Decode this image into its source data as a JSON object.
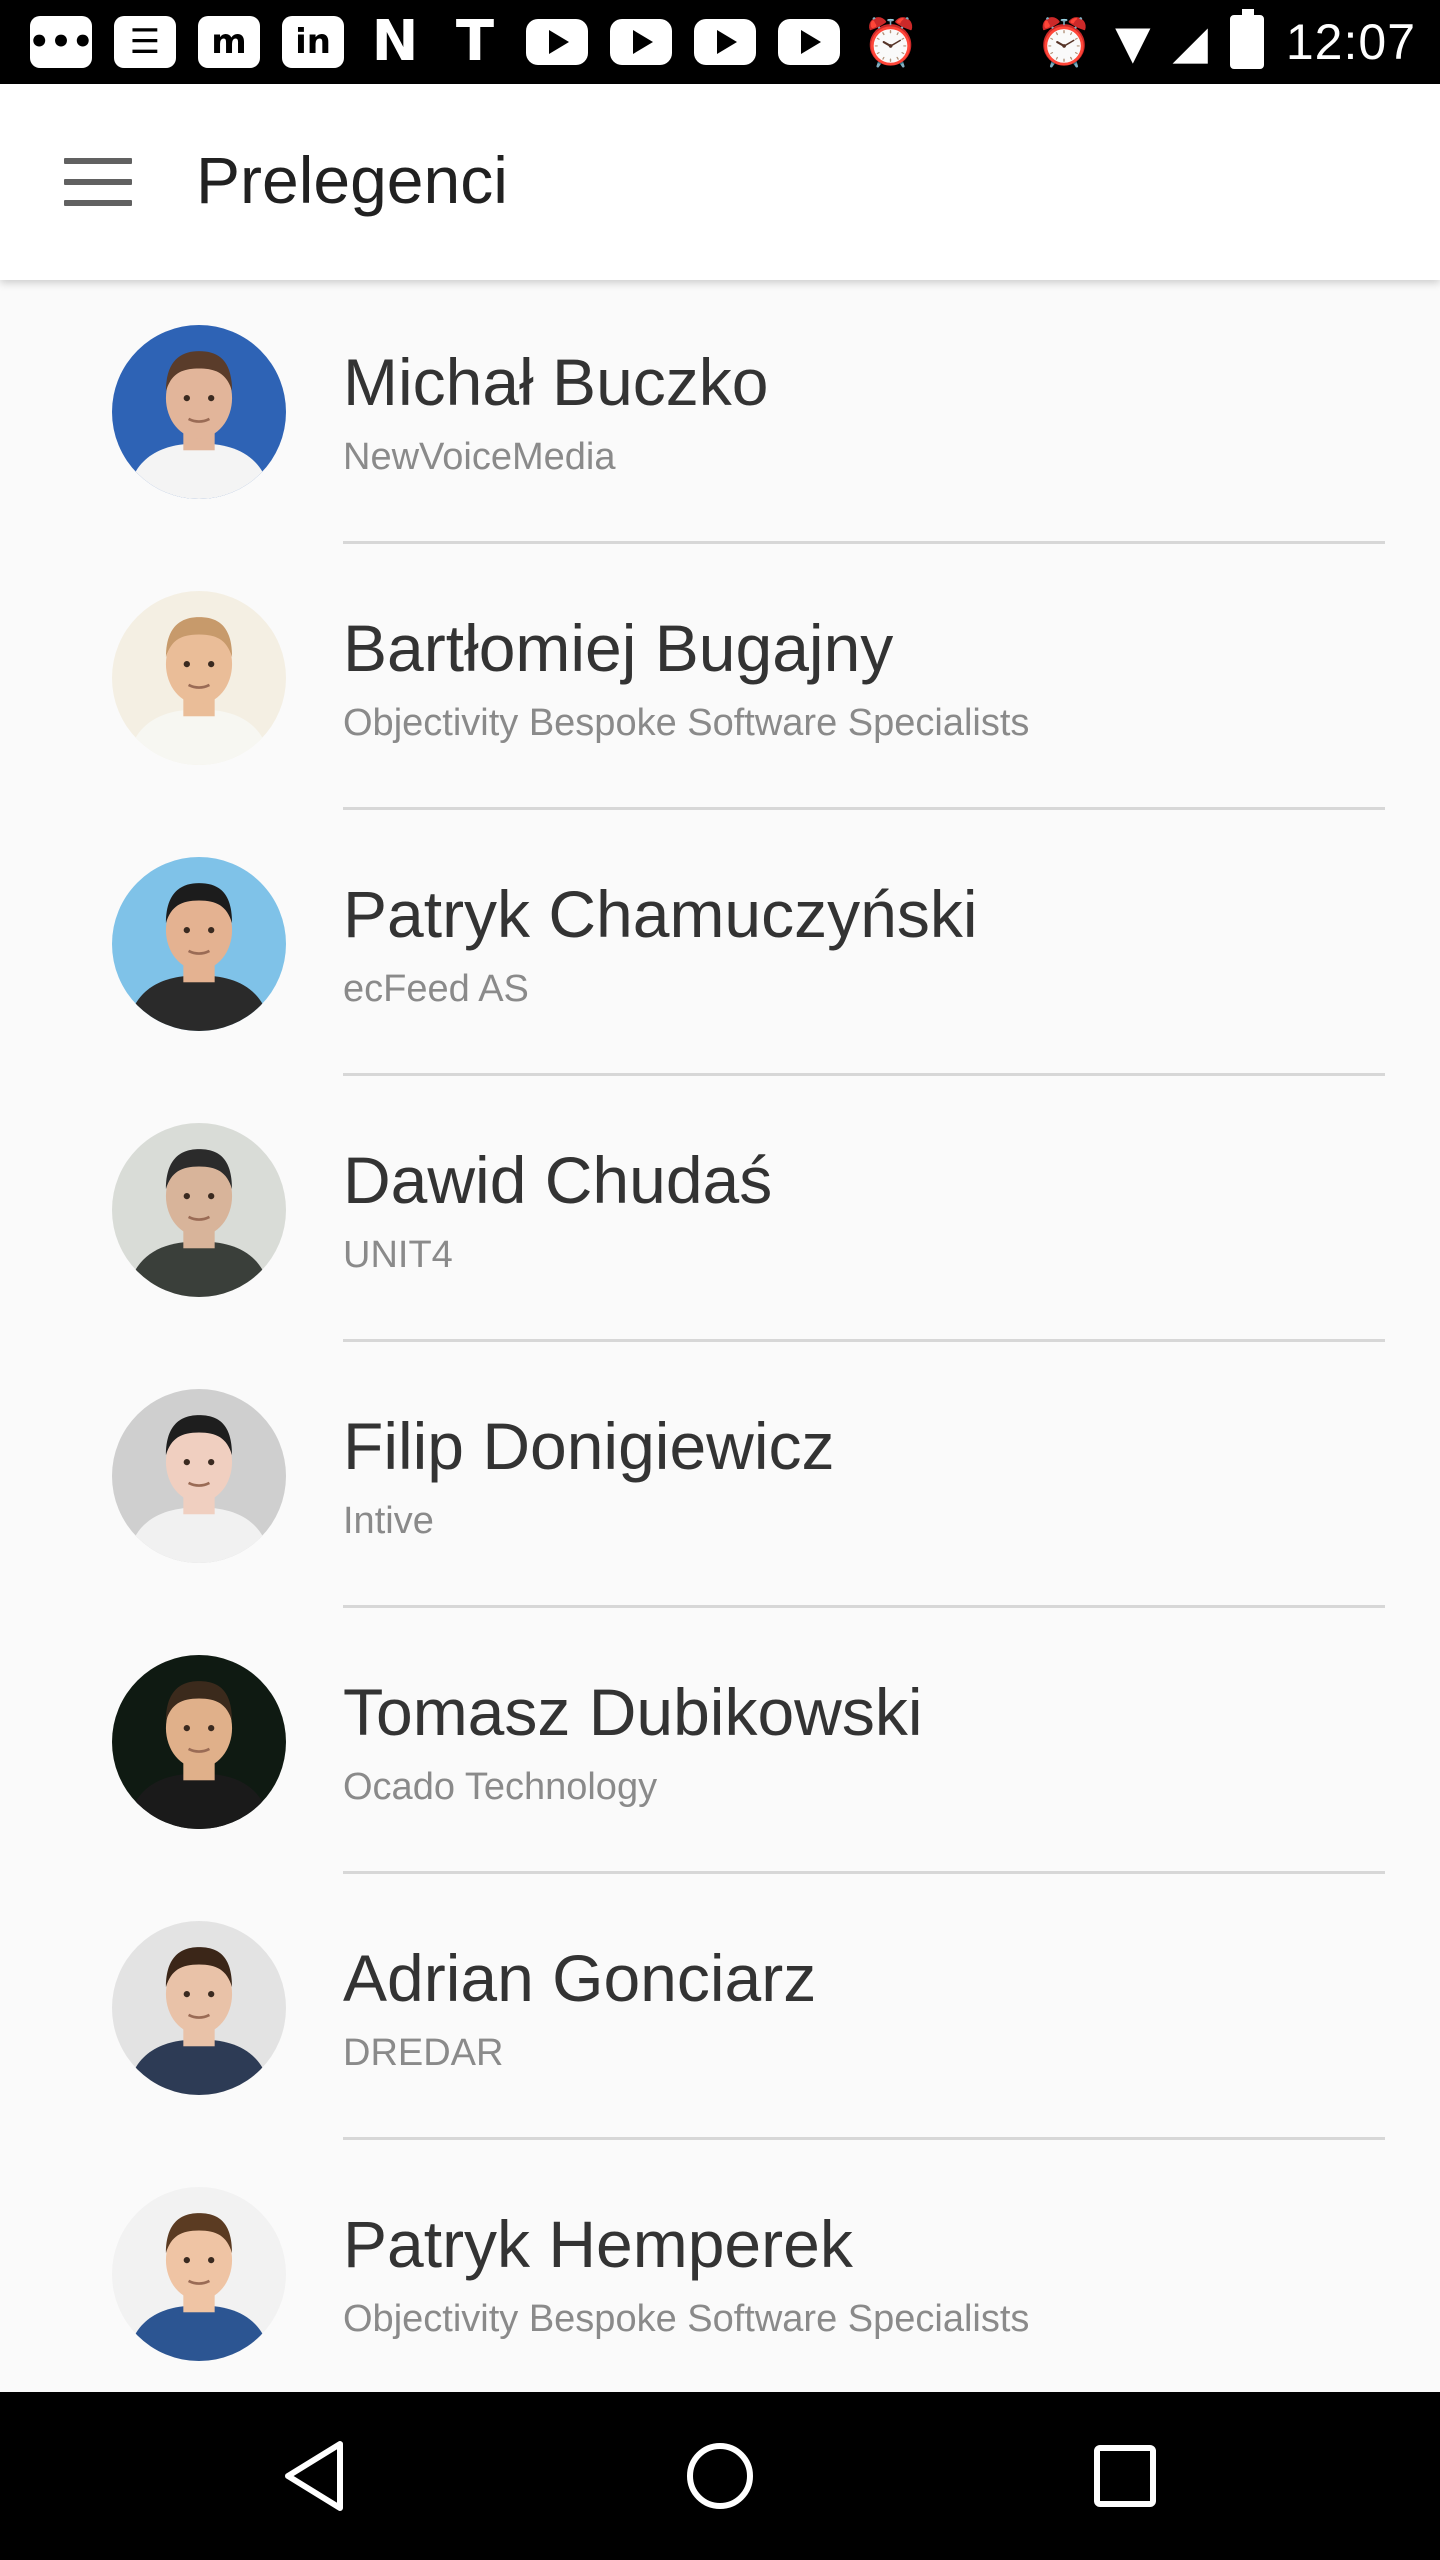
{
  "status_bar": {
    "time": "12:07",
    "notification_icons": [
      {
        "name": "chat-icon",
        "glyph": "•••",
        "style": "box"
      },
      {
        "name": "news-icon",
        "glyph": "☰",
        "style": "box"
      },
      {
        "name": "m-app-icon",
        "glyph": "m",
        "style": "box"
      },
      {
        "name": "linkedin-icon",
        "glyph": "in",
        "style": "box"
      },
      {
        "name": "wpunkt-icon",
        "glyph": "N",
        "style": "plain"
      },
      {
        "name": "t-app-icon",
        "glyph": "T",
        "style": "plain"
      },
      {
        "name": "youtube-icon",
        "glyph": "",
        "style": "yt"
      },
      {
        "name": "youtube-icon",
        "glyph": "",
        "style": "yt"
      },
      {
        "name": "youtube-icon",
        "glyph": "",
        "style": "yt"
      },
      {
        "name": "youtube-icon",
        "glyph": "",
        "style": "yt"
      },
      {
        "name": "alarm-icon",
        "glyph": "⏰",
        "style": "glyph"
      }
    ],
    "system_icons": [
      {
        "name": "alarm-icon",
        "glyph": "⏰"
      },
      {
        "name": "wifi-icon",
        "glyph": "▼"
      },
      {
        "name": "signal-icon",
        "glyph": "◢"
      }
    ]
  },
  "app_bar": {
    "title": "Prelegenci",
    "menu_icon": "hamburger-menu-icon"
  },
  "speakers": [
    {
      "name": "Michał Buczko",
      "company": "NewVoiceMedia",
      "avatar_bg": "#2e63b5",
      "skin": "#e2b59a",
      "hair": "#5a3c2a",
      "shirt": "#f4f4f4"
    },
    {
      "name": "Bartłomiej Bugajny",
      "company": "Objectivity Bespoke Software Specialists",
      "avatar_bg": "#f4efe3",
      "skin": "#eabd98",
      "hair": "#c79a6b",
      "shirt": "#f7f7f2"
    },
    {
      "name": "Patryk Chamuczyński",
      "company": "ecFeed AS",
      "avatar_bg": "#7fc2e8",
      "skin": "#e4b291",
      "hair": "#1c1c1c",
      "shirt": "#2a2a2a"
    },
    {
      "name": "Dawid Chudaś",
      "company": "UNIT4",
      "avatar_bg": "#d9dcd7",
      "skin": "#d8b49a",
      "hair": "#2b2b2b",
      "shirt": "#3a3f3a"
    },
    {
      "name": "Filip Donigiewicz",
      "company": "Intive",
      "avatar_bg": "#cfcfcf",
      "skin": "#f0cfc0",
      "hair": "#1e1e1e",
      "shirt": "#f1f1f1"
    },
    {
      "name": "Tomasz Dubikowski",
      "company": "Ocado Technology",
      "avatar_bg": "#0f1a12",
      "skin": "#e0b08a",
      "hair": "#3b2a1c",
      "shirt": "#1a1a1a"
    },
    {
      "name": "Adrian Gonciarz",
      "company": "DREDAR",
      "avatar_bg": "#e3e3e3",
      "skin": "#e9c2a8",
      "hair": "#3b2618",
      "shirt": "#2d3b55"
    },
    {
      "name": "Patryk Hemperek",
      "company": "Objectivity Bespoke Software Specialists",
      "avatar_bg": "#f2f2f2",
      "skin": "#efc4a4",
      "hair": "#5b3b22",
      "shirt": "#2c5592"
    }
  ],
  "nav_bar": {
    "back_icon": "back-icon",
    "home_icon": "home-icon",
    "recents_icon": "recents-icon"
  },
  "colors": {
    "app_bar_bg": "#ffffff",
    "list_bg": "#fafafa",
    "name_text": "#333333",
    "company_text": "#8a8a8a",
    "divider": "#d7d7d7"
  }
}
